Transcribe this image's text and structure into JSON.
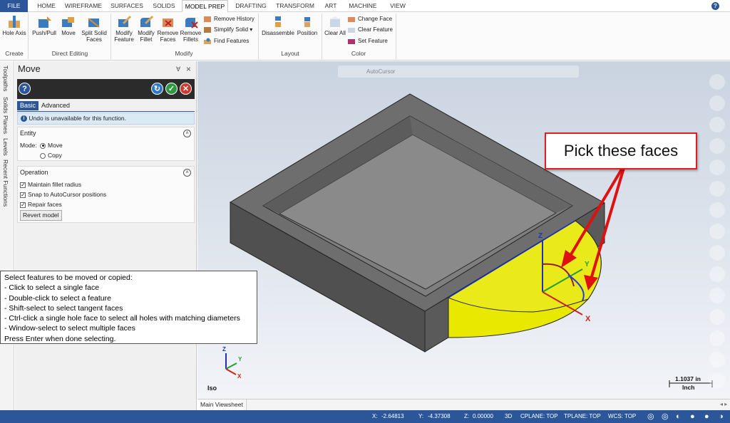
{
  "menu": {
    "tabs": [
      "FILE",
      "HOME",
      "WIREFRAME",
      "SURFACES",
      "SOLIDS",
      "MODEL PREP",
      "DRAFTING",
      "TRANSFORM",
      "ART",
      "MACHINE",
      "VIEW"
    ],
    "active": "MODEL PREP",
    "help": "?"
  },
  "ribbon": {
    "hole_axis": "Hole Axis",
    "push_pull": "Push/Pull",
    "move": "Move",
    "split_solid_faces": "Split Solid Faces",
    "modify_feature": "Modify Feature",
    "modify_fillet": "Modify Fillet",
    "remove_faces": "Remove Faces",
    "remove_fillets": "Remove Fillets",
    "remove_history": "Remove History",
    "simplify_solid": "Simplify Solid",
    "find_features": "Find Features",
    "disassemble": "Disassemble",
    "position": "Position",
    "clear_all": "Clear All",
    "change_face": "Change Face",
    "clear_feature": "Clear Feature",
    "set_feature": "Set Feature",
    "groups": {
      "create": "Create",
      "direct_editing": "Direct Editing",
      "modify": "Modify",
      "layout": "Layout",
      "color": "Color"
    }
  },
  "side_tabs": [
    "Toolpaths",
    "Solids",
    "Planes",
    "Levels",
    "Recent Functions"
  ],
  "panel": {
    "title": "Move",
    "pin": "∀",
    "close": "×",
    "tab_basic": "Basic",
    "tab_advanced": "Advanced",
    "info": "Undo is unavailable for this function.",
    "entity": {
      "header": "Entity",
      "mode_label": "Mode:",
      "option_move": "Move",
      "option_copy": "Copy",
      "selected": "Move"
    },
    "operation": {
      "header": "Operation",
      "options": [
        {
          "label": "Maintain fillet radius",
          "checked": true
        },
        {
          "label": "Snap to AutoCursor positions",
          "checked": true
        },
        {
          "label": "Repair faces",
          "checked": true
        }
      ],
      "revert": "Revert model"
    }
  },
  "prompt": {
    "lines": [
      "Select features to be moved or copied:",
      "- Click to select a single face",
      "- Double-click to select a feature",
      "- Shift-select to select tangent faces",
      "- Ctrl-click a single hole face to select all holes with matching diameters",
      "- Window-select to select multiple faces",
      "Press Enter when done selecting."
    ]
  },
  "viewport": {
    "autocursor": "AutoCursor",
    "callout": "Pick these faces",
    "gnomon": {
      "z": "Z",
      "y": "Y",
      "x": "X"
    },
    "view_name": "Iso",
    "scale_value": "1.1037 in",
    "scale_unit": "Inch"
  },
  "sheet": {
    "tab": "Main Viewsheet"
  },
  "status": {
    "x_label": "X:",
    "x_value": "-2.64813",
    "y_label": "Y:",
    "y_value": "-4.37308",
    "z_label": "Z:",
    "z_value": "0.00000",
    "mode": "3D",
    "cplane": "CPLANE: TOP",
    "tplane": "TPLANE: TOP",
    "wcs": "WCS: TOP"
  },
  "colors": {
    "accent": "#2b579a",
    "highlight": "#e8e800",
    "callout_border": "#e02020",
    "solid_gray": "#6e6e6e"
  }
}
